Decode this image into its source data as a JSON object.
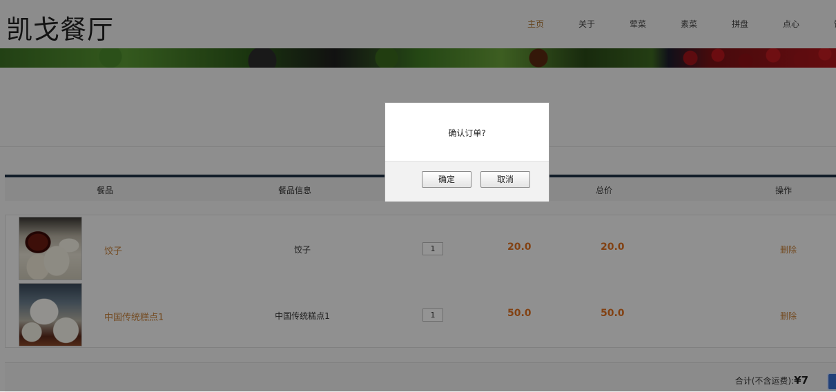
{
  "header": {
    "logo": "凯戈餐厅",
    "nav": [
      "主页",
      "关于",
      "荤菜",
      "素菜",
      "拼盘",
      "点心",
      "饮"
    ]
  },
  "cart": {
    "columns": [
      "餐品",
      "餐品信息",
      "总价",
      "操作"
    ],
    "rows": [
      {
        "name": "饺子",
        "info": "饺子",
        "qty": "1",
        "price": "20.0",
        "total": "20.0",
        "action": "删除",
        "image": "dumpling-photo"
      },
      {
        "name": "中国传统糕点1",
        "info": "中国传统糕点1",
        "qty": "1",
        "price": "50.0",
        "total": "50.0",
        "action": "删除",
        "image": "cake-photo"
      }
    ],
    "summary_label": "合计(不含运费):",
    "currency": "¥",
    "summary_value_partial": "7"
  },
  "dialog": {
    "message": "确认订单?",
    "confirm": "确定",
    "cancel": "取消"
  },
  "colors": {
    "accent": "#c8843e",
    "price": "#e07020",
    "table_border": "#1f3348"
  }
}
